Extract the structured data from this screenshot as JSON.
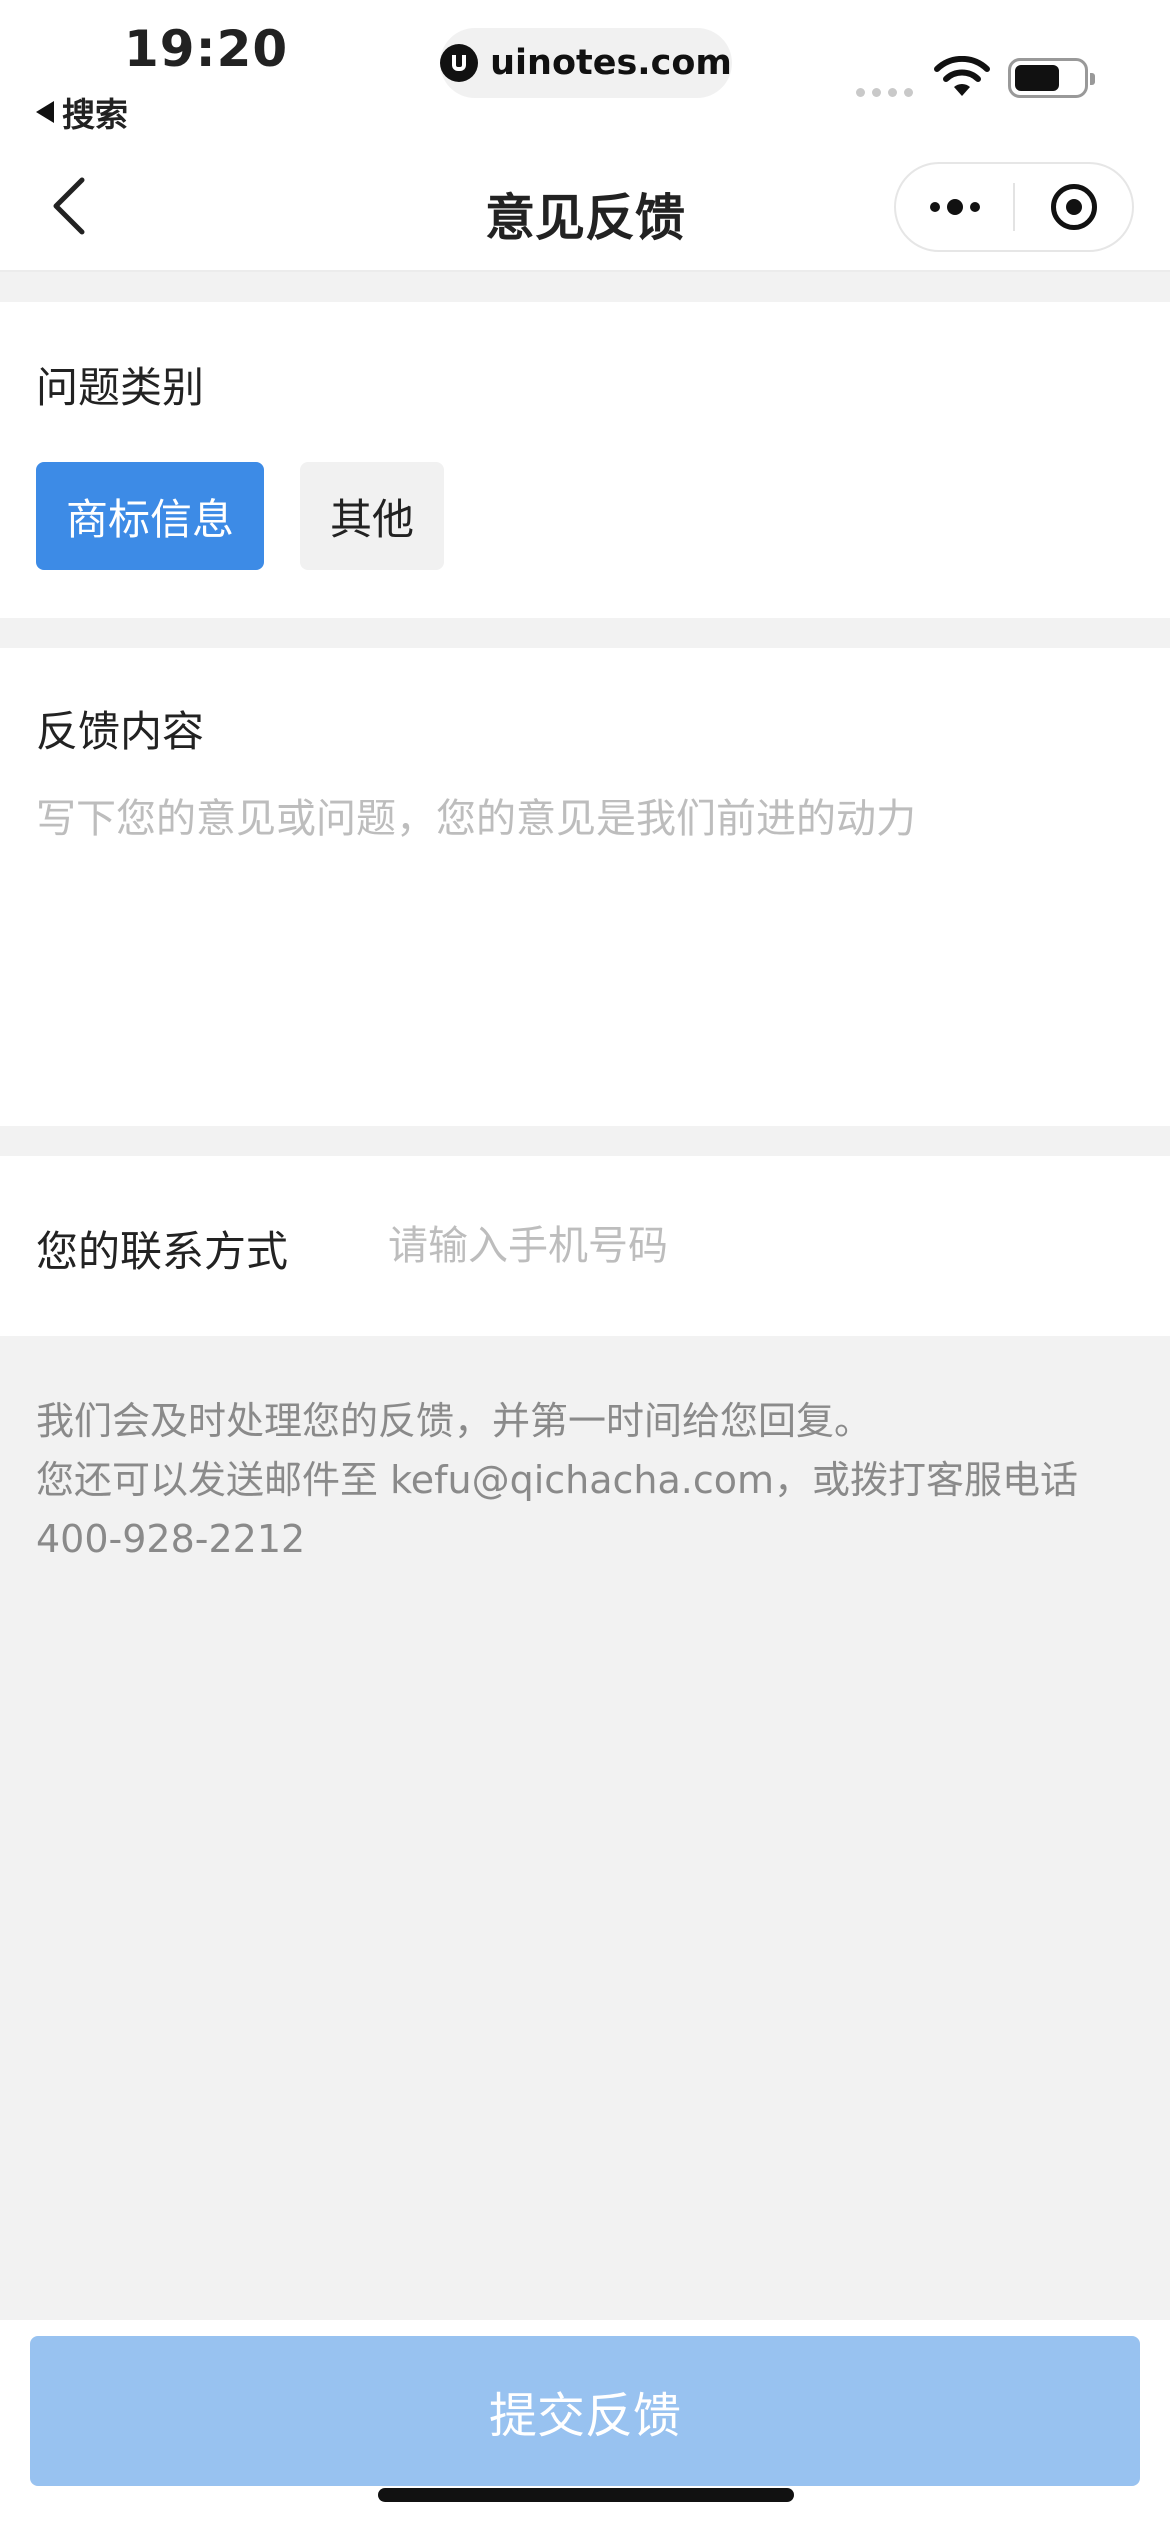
{
  "status_bar": {
    "time": "19:20",
    "back_app_label": "搜索",
    "url": "uinotes.com"
  },
  "nav": {
    "title": "意见反馈",
    "back_icon": "chevron-left-icon",
    "more_icon": "more-dots-icon",
    "close_icon": "target-icon"
  },
  "category": {
    "label": "问题类别",
    "options": [
      {
        "label": "商标信息",
        "selected": true
      },
      {
        "label": "其他",
        "selected": false
      }
    ]
  },
  "content": {
    "label": "反馈内容",
    "placeholder": "写下您的意见或问题，您的意见是我们前进的动力",
    "value": ""
  },
  "contact": {
    "label": "您的联系方式",
    "placeholder": "请输入手机号码",
    "value": ""
  },
  "note": {
    "line1": "我们会及时处理您的反馈，并第一时间给您回复。",
    "line2": "您还可以发送邮件至 kefu@qichacha.com，或拨打客服电话",
    "line3": "400-928-2212"
  },
  "submit_label": "提交反馈",
  "colors": {
    "accent": "#3d8be6",
    "submit_disabled": "#98c2f0",
    "page_bg": "#f2f2f2"
  }
}
